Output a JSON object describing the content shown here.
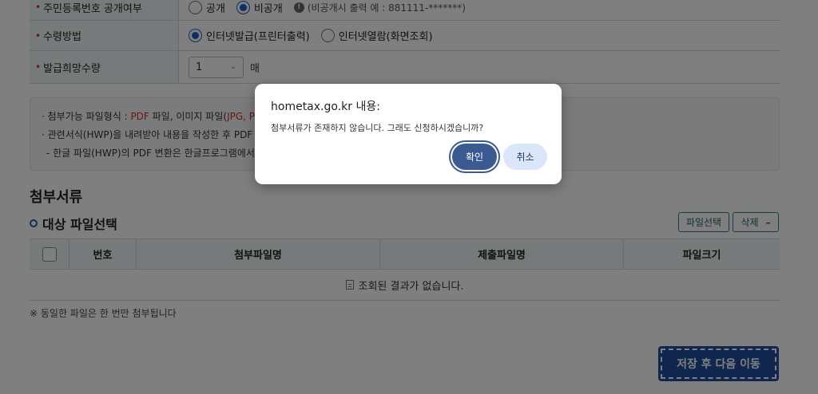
{
  "form": {
    "rows": [
      {
        "label": "주민등록번호 공개여부",
        "options": [
          "공개",
          "비공개"
        ],
        "selected": 1,
        "hint": "(비공개시 출력 예 : 881111-*******)"
      },
      {
        "label": "수령방법",
        "options": [
          "인터넷발급(프린터출력)",
          "인터넷열람(화면조회)"
        ],
        "selected": 0
      },
      {
        "label": "발급희망수량",
        "select_value": "1",
        "unit": "매"
      }
    ]
  },
  "notice": {
    "line1_prefix": "· 첨부가능 파일형식 : ",
    "line1_pdf": "PDF",
    "line1_mid": " 파일, 이미지 파일(",
    "line1_jpg": "JPG, P",
    "line2": "· 관련서식(HWP)을 내려받아 내용을 작성한 후 PDF",
    "line3": "- 한글 파일(HWP)의 PDF 변환은 한글프로그램에서"
  },
  "attachments": {
    "section_title": "첨부서류",
    "sub_title": "대상 파일선택",
    "select_file_label": "파일선택",
    "delete_label": "삭제",
    "delete_icon": "minus-icon",
    "columns": [
      "번호",
      "첨부파일명",
      "제출파일명",
      "파일크기"
    ],
    "empty_message": "조회된 결과가 없습니다.",
    "footnote": "※ 동일한 파일은 한 번만 첨부됩니다"
  },
  "save_next_label": "저장 후 다음 이동",
  "dialog": {
    "title": "hometax.go.kr 내용:",
    "message": "첨부서류가 존재하지 않습니다. 그래도 신청하시겠습니까?",
    "ok_label": "확인",
    "cancel_label": "취소"
  },
  "colors": {
    "accent": "#1f4e9c",
    "required": "#d32f2f",
    "dialog_primary": "#3b5a92",
    "dialog_secondary": "#dbe6fb"
  }
}
